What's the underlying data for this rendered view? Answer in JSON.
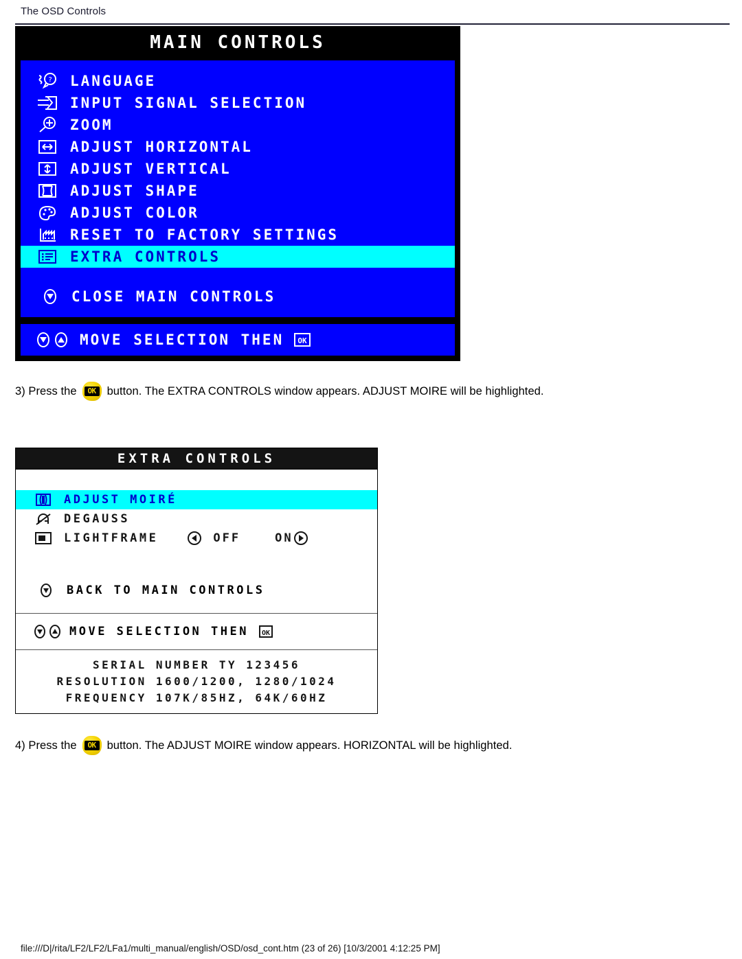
{
  "page": {
    "header_title": "The OSD Controls",
    "footer": "file:///D|/rita/LF2/LF2/LFa1/multi_manual/english/OSD/osd_cont.htm (23 of 26) [10/3/2001 4:12:25 PM]"
  },
  "colors": {
    "osd_blue": "#0000FF",
    "osd_highlight_cyan": "#00FFFF",
    "osd_title_black": "#000000",
    "osd_text_white": "#FFFFFF",
    "ok_button_yellow": "#F5D400"
  },
  "main_controls": {
    "title": "MAIN CONTROLS",
    "items": [
      {
        "icon": "language-person-question-icon",
        "label": "LANGUAGE",
        "highlighted": false
      },
      {
        "icon": "input-signal-arrow-icon",
        "label": "INPUT SIGNAL SELECTION",
        "highlighted": false
      },
      {
        "icon": "zoom-magnifier-plus-icon",
        "label": "ZOOM",
        "highlighted": false
      },
      {
        "icon": "adjust-horizontal-arrows-icon",
        "label": "ADJUST HORIZONTAL",
        "highlighted": false
      },
      {
        "icon": "adjust-vertical-arrows-icon",
        "label": "ADJUST VERTICAL",
        "highlighted": false
      },
      {
        "icon": "adjust-shape-pincushion-icon",
        "label": "ADJUST SHAPE",
        "highlighted": false
      },
      {
        "icon": "adjust-color-palette-icon",
        "label": "ADJUST COLOR",
        "highlighted": false
      },
      {
        "icon": "reset-factory-icon",
        "label": "RESET TO FACTORY SETTINGS",
        "highlighted": false
      },
      {
        "icon": "extra-controls-list-icon",
        "label": "EXTRA CONTROLS",
        "highlighted": true
      }
    ],
    "close_item": {
      "icon": "down-triangle-circle-icon",
      "label": "CLOSE MAIN CONTROLS"
    },
    "footer_hint": {
      "icons": [
        "down-triangle-circle-icon",
        "up-triangle-circle-icon"
      ],
      "label": "MOVE SELECTION THEN",
      "ok_icon": "ok-key-icon"
    }
  },
  "extra_controls": {
    "title": "EXTRA CONTROLS",
    "items": [
      {
        "icon": "moire-icon",
        "label": "ADJUST MOIRÉ",
        "highlighted": true,
        "options": []
      },
      {
        "icon": "degauss-magnet-icon",
        "label": "DEGAUSS",
        "highlighted": false,
        "options": []
      },
      {
        "icon": "lightframe-screen-icon",
        "label": "LIGHTFRAME",
        "highlighted": false,
        "options": [
          {
            "arrow": "left-arrow-circle-icon",
            "text": "OFF",
            "arrow_side": "before"
          },
          {
            "arrow": "right-arrow-circle-icon",
            "text": "ON",
            "arrow_side": "after"
          }
        ]
      }
    ],
    "back_item": {
      "icon": "down-triangle-circle-icon",
      "label": "BACK TO MAIN CONTROLS"
    },
    "footer_hint": {
      "icons": [
        "down-triangle-circle-icon",
        "up-triangle-circle-icon"
      ],
      "label": "MOVE SELECTION THEN",
      "ok_icon": "ok-key-icon"
    },
    "info": {
      "serial": "SERIAL NUMBER TY 123456",
      "resolution": "RESOLUTION 1600/1200, 1280/1024",
      "frequency": "FREQUENCY 107K/85HZ, 64K/60HZ"
    }
  },
  "steps": [
    {
      "id": "step-3",
      "prefix": "3) Press the",
      "button_icon": "ok-button-icon",
      "button_text": "OK",
      "suffix": "button. The EXTRA CONTROLS window appears. ADJUST MOIRE will be highlighted."
    },
    {
      "id": "step-4",
      "prefix": "4) Press the",
      "button_icon": "ok-button-icon",
      "button_text": "OK",
      "suffix": "button. The ADJUST MOIRE window appears. HORIZONTAL will be highlighted."
    }
  ]
}
